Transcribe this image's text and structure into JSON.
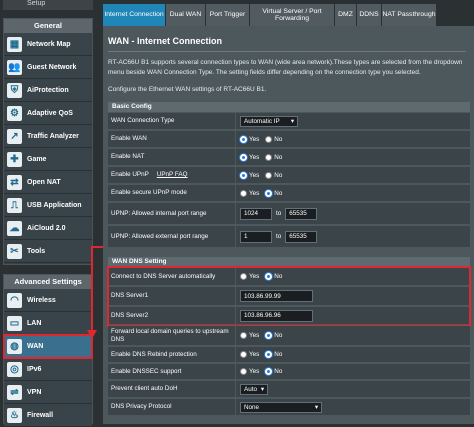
{
  "sidebar": {
    "top_item": "Setup",
    "general_header": "General",
    "general_items": [
      {
        "label": "Network Map",
        "icon": "network-map-icon",
        "glyph": "▦"
      },
      {
        "label": "Guest Network",
        "icon": "guest-network-icon",
        "glyph": "👥"
      },
      {
        "label": "AiProtection",
        "icon": "shield-icon",
        "glyph": "⛨"
      },
      {
        "label": "Adaptive QoS",
        "icon": "qos-icon",
        "glyph": "⚙"
      },
      {
        "label": "Traffic Analyzer",
        "icon": "traffic-analyzer-icon",
        "glyph": "↗"
      },
      {
        "label": "Game",
        "icon": "game-icon",
        "glyph": "✚"
      },
      {
        "label": "Open NAT",
        "icon": "open-nat-icon",
        "glyph": "⇄"
      },
      {
        "label": "USB Application",
        "icon": "usb-icon",
        "glyph": "⎍"
      },
      {
        "label": "AiCloud 2.0",
        "icon": "cloud-icon",
        "glyph": "☁"
      },
      {
        "label": "Tools",
        "icon": "tools-icon",
        "glyph": "✂"
      }
    ],
    "advanced_header": "Advanced Settings",
    "advanced_items": [
      {
        "label": "Wireless",
        "icon": "wireless-icon",
        "glyph": "◠"
      },
      {
        "label": "LAN",
        "icon": "lan-icon",
        "glyph": "▭"
      },
      {
        "label": "WAN",
        "icon": "wan-globe-icon",
        "glyph": "◍"
      },
      {
        "label": "IPv6",
        "icon": "ipv6-icon",
        "glyph": "◎"
      },
      {
        "label": "VPN",
        "icon": "vpn-icon",
        "glyph": "⇌"
      },
      {
        "label": "Firewall",
        "icon": "firewall-icon",
        "glyph": "♨"
      }
    ],
    "active_item": "WAN"
  },
  "tabs": [
    {
      "label": "Internet Connection",
      "active": true
    },
    {
      "label": "Dual WAN",
      "active": false
    },
    {
      "label": "Port Trigger",
      "active": false
    },
    {
      "label": "Virtual Server / Port Forwarding",
      "active": false
    },
    {
      "label": "DMZ",
      "active": false
    },
    {
      "label": "DDNS",
      "active": false
    },
    {
      "label": "NAT Passthrough",
      "active": false
    }
  ],
  "main": {
    "title": "WAN - Internet Connection",
    "description": "RT-AC66U B1 supports several connection types to WAN (wide area network).These types are selected from the dropdown menu beside WAN Connection Type. The setting fields differ depending on the connection type you selected.",
    "subdescription": "Configure the Ethernet WAN settings of RT-AC66U B1.",
    "basic_header": "Basic Config",
    "wan_type_label": "WAN Connection Type",
    "wan_type_value": "Automatic IP",
    "enable_wan_label": "Enable WAN",
    "enable_nat_label": "Enable NAT",
    "enable_upnp_label": "Enable UPnP",
    "upnp_faq": "UPnP FAQ",
    "secure_upnp_label": "Enable secure UPnP mode",
    "upnp_internal_label": "UPNP: Allowed internal port range",
    "upnp_internal_from": "1024",
    "upnp_internal_to": "65535",
    "upnp_external_label": "UPNP: Allowed external port range",
    "upnp_external_from": "1",
    "upnp_external_to": "65535",
    "to_label": "to",
    "yes": "Yes",
    "no": "No",
    "dns_header": "WAN DNS Setting",
    "dns_auto_label": "Connect to DNS Server automatically",
    "dns1_label": "DNS Server1",
    "dns1_value": "103.86.99.99",
    "dns2_label": "DNS Server2",
    "dns2_value": "103.86.96.96",
    "forward_label": "Forward local domain queries to upstream DNS",
    "rebind_label": "Enable DNS Rebind protection",
    "dnssec_label": "Enable DNSSEC support",
    "doh_label": "Prevent client auto DoH",
    "doh_value": "Auto",
    "privacy_label": "DNS Privacy Protocol",
    "privacy_value": "None"
  },
  "colors": {
    "accent": "#1f86b7",
    "highlight": "#e0262f"
  }
}
